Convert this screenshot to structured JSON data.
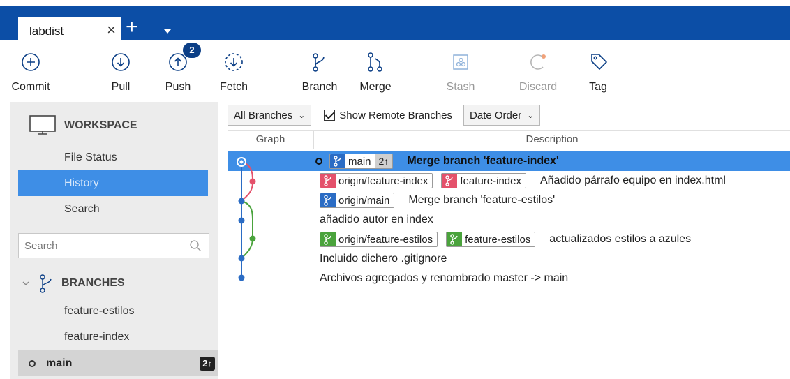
{
  "tab": {
    "title": "labdist",
    "close": "×",
    "add": "+"
  },
  "toolbar": {
    "commit": "Commit",
    "pull": "Pull",
    "push": "Push",
    "push_badge": "2",
    "fetch": "Fetch",
    "branch": "Branch",
    "merge": "Merge",
    "stash": "Stash",
    "discard": "Discard",
    "tag": "Tag"
  },
  "sidebar": {
    "workspace": "WORKSPACE",
    "items": [
      {
        "label": "File Status"
      },
      {
        "label": "History"
      },
      {
        "label": "Search"
      }
    ],
    "search_placeholder": "Search",
    "branches_title": "BRANCHES",
    "branches": [
      {
        "label": "feature-estilos"
      },
      {
        "label": "feature-index"
      }
    ],
    "current_branch": {
      "label": "main",
      "badge": "2↑"
    }
  },
  "filters": {
    "branches_select": "All Branches",
    "show_remote": "Show Remote Branches",
    "order_select": "Date Order"
  },
  "columns": {
    "graph": "Graph",
    "description": "Description"
  },
  "commits": [
    {
      "refs": [
        {
          "name": "main",
          "color": "blue",
          "ahead": "2↑"
        }
      ],
      "message": "Merge branch 'feature-index'"
    },
    {
      "refs": [
        {
          "name": "origin/feature-index",
          "color": "red"
        },
        {
          "name": "feature-index",
          "color": "red"
        }
      ],
      "message": "Añadido párrafo equipo en index.html"
    },
    {
      "refs": [
        {
          "name": "origin/main",
          "color": "blue"
        }
      ],
      "message": "Merge branch 'feature-estilos'"
    },
    {
      "refs": [],
      "message": "añadido autor en index"
    },
    {
      "refs": [
        {
          "name": "origin/feature-estilos",
          "color": "green"
        },
        {
          "name": "feature-estilos",
          "color": "green"
        }
      ],
      "message": "actualizados estilos a azules"
    },
    {
      "refs": [],
      "message": "Incluido dichero .gitignore"
    },
    {
      "refs": [],
      "message": "Archivos agregados y renombrado master -> main"
    }
  ],
  "colors": {
    "accent": "#3e8ee6",
    "tabbar": "#0c4ea6",
    "red": "#e4516b",
    "blue": "#2b6cc4",
    "green": "#4aa33c"
  }
}
